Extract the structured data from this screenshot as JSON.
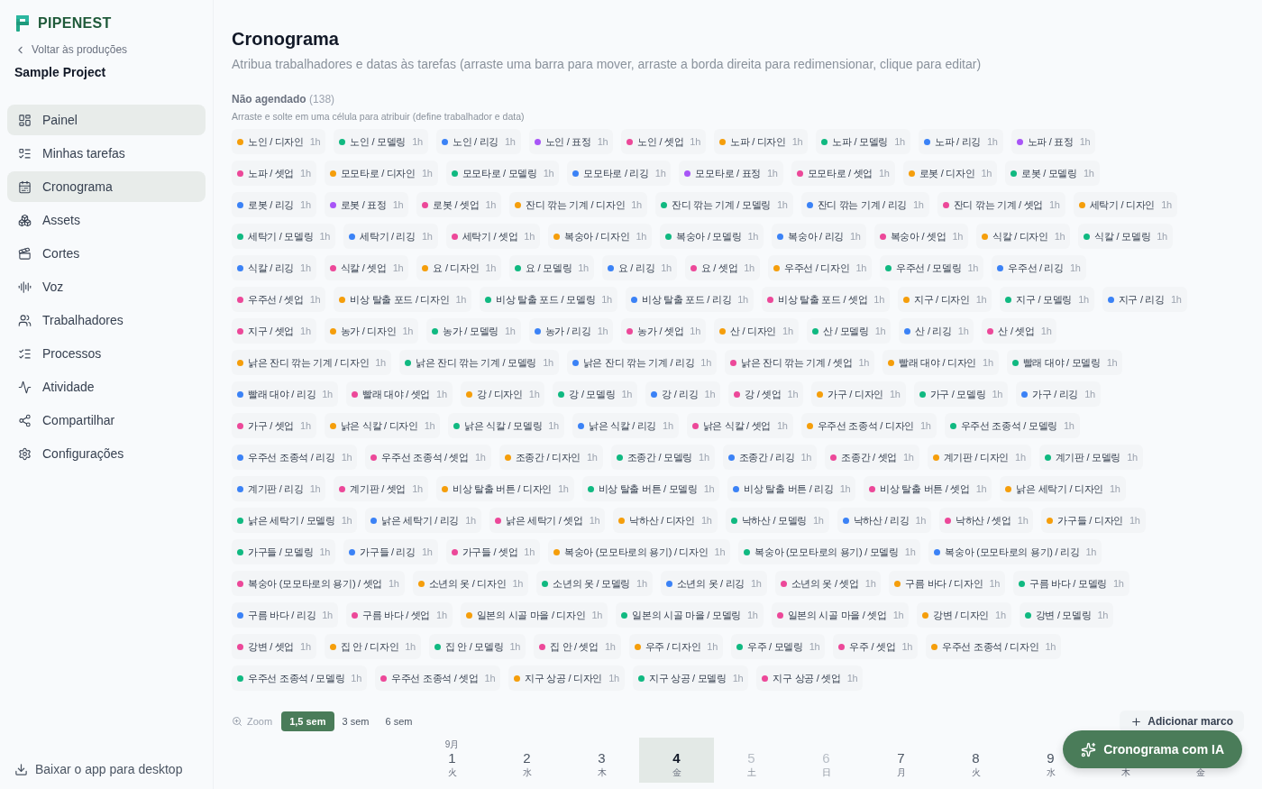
{
  "sidebar": {
    "brand": "PIPENEST",
    "back_link": "Voltar às produções",
    "project": "Sample Project",
    "items": [
      {
        "label": "Painel",
        "selected": true
      },
      {
        "label": "Minhas tarefas",
        "selected": false
      },
      {
        "label": "Cronograma",
        "selected": true
      },
      {
        "label": "Assets",
        "selected": false
      },
      {
        "label": "Cortes",
        "selected": false
      },
      {
        "label": "Voz",
        "selected": false
      },
      {
        "label": "Trabalhadores",
        "selected": false
      },
      {
        "label": "Processos",
        "selected": false
      },
      {
        "label": "Atividade",
        "selected": false
      },
      {
        "label": "Compartilhar",
        "selected": false
      },
      {
        "label": "Configurações",
        "selected": false
      }
    ],
    "download": "Baixar o app para desktop"
  },
  "page": {
    "title": "Cronograma",
    "subtitle": "Atribua trabalhadores e datas às tarefas (arraste uma barra para mover, arraste a borda direita para redimensionar, clique para editar)"
  },
  "unscheduled": {
    "title": "Não agendado",
    "count": "(138)",
    "hint": "Arraste e solte em uma célula para atribuir (define trabalhador e data)",
    "rows": [
      [
        {
          "label": "노인 / 디자인",
          "hours": "1h",
          "color": "#f59e0b"
        },
        {
          "label": "노인 / 모델링",
          "hours": "1h",
          "color": "#10b981"
        },
        {
          "label": "노인 / 리깅",
          "hours": "1h",
          "color": "#3b82f6"
        },
        {
          "label": "노인 / 표정",
          "hours": "1h",
          "color": "#a855f7"
        },
        {
          "label": "노인 / 셋업",
          "hours": "1h",
          "color": "#ec4899"
        },
        {
          "label": "노파 / 디자인",
          "hours": "1h",
          "color": "#f59e0b"
        },
        {
          "label": "노파 / 모델링",
          "hours": "1h",
          "color": "#10b981"
        },
        {
          "label": "노파 / 리깅",
          "hours": "1h",
          "color": "#3b82f6"
        },
        {
          "label": "노파 / 표정",
          "hours": "1h",
          "color": "#a855f7"
        }
      ],
      [
        {
          "label": "노파 / 셋업",
          "hours": "1h",
          "color": "#ec4899"
        },
        {
          "label": "모모타로 / 디자인",
          "hours": "1h",
          "color": "#f59e0b"
        },
        {
          "label": "모모타로 / 모델링",
          "hours": "1h",
          "color": "#10b981"
        },
        {
          "label": "모모타로 / 리깅",
          "hours": "1h",
          "color": "#3b82f6"
        },
        {
          "label": "모모타로 / 표정",
          "hours": "1h",
          "color": "#a855f7"
        },
        {
          "label": "모모타로 / 셋업",
          "hours": "1h",
          "color": "#ec4899"
        },
        {
          "label": "로봇 / 디자인",
          "hours": "1h",
          "color": "#f59e0b"
        },
        {
          "label": "로봇 / 모델링",
          "hours": "1h",
          "color": "#10b981"
        }
      ],
      [
        {
          "label": "로봇 / 리깅",
          "hours": "1h",
          "color": "#3b82f6"
        },
        {
          "label": "로봇 / 표정",
          "hours": "1h",
          "color": "#a855f7"
        },
        {
          "label": "로봇 / 셋업",
          "hours": "1h",
          "color": "#ec4899"
        },
        {
          "label": "잔디 깎는 기계 / 디자인",
          "hours": "1h",
          "color": "#f59e0b"
        },
        {
          "label": "잔디 깎는 기계 / 모델링",
          "hours": "1h",
          "color": "#10b981"
        },
        {
          "label": "잔디 깎는 기계 / 리깅",
          "hours": "1h",
          "color": "#3b82f6"
        },
        {
          "label": "잔디 깎는 기계 / 셋업",
          "hours": "1h",
          "color": "#ec4899"
        },
        {
          "label": "세탁기 / 디자인",
          "hours": "1h",
          "color": "#f59e0b"
        }
      ],
      [
        {
          "label": "세탁기 / 모델링",
          "hours": "1h",
          "color": "#10b981"
        },
        {
          "label": "세탁기 / 리깅",
          "hours": "1h",
          "color": "#3b82f6"
        },
        {
          "label": "세탁기 / 셋업",
          "hours": "1h",
          "color": "#ec4899"
        },
        {
          "label": "복숭아 / 디자인",
          "hours": "1h",
          "color": "#f59e0b"
        },
        {
          "label": "복숭아 / 모델링",
          "hours": "1h",
          "color": "#10b981"
        },
        {
          "label": "복숭아 / 리깅",
          "hours": "1h",
          "color": "#3b82f6"
        },
        {
          "label": "복숭아 / 셋업",
          "hours": "1h",
          "color": "#ec4899"
        },
        {
          "label": "식칼 / 디자인",
          "hours": "1h",
          "color": "#f59e0b"
        },
        {
          "label": "식칼 / 모델링",
          "hours": "1h",
          "color": "#10b981"
        }
      ],
      [
        {
          "label": "식칼 / 리깅",
          "hours": "1h",
          "color": "#3b82f6"
        },
        {
          "label": "식칼 / 셋업",
          "hours": "1h",
          "color": "#ec4899"
        },
        {
          "label": "요 / 디자인",
          "hours": "1h",
          "color": "#f59e0b"
        },
        {
          "label": "요 / 모델링",
          "hours": "1h",
          "color": "#10b981"
        },
        {
          "label": "요 / 리깅",
          "hours": "1h",
          "color": "#3b82f6"
        },
        {
          "label": "요 / 셋업",
          "hours": "1h",
          "color": "#ec4899"
        },
        {
          "label": "우주선 / 디자인",
          "hours": "1h",
          "color": "#f59e0b"
        },
        {
          "label": "우주선 / 모델링",
          "hours": "1h",
          "color": "#10b981"
        },
        {
          "label": "우주선 / 리깅",
          "hours": "1h",
          "color": "#3b82f6"
        }
      ],
      [
        {
          "label": "우주선 / 셋업",
          "hours": "1h",
          "color": "#ec4899"
        },
        {
          "label": "비상 탈출 포드 / 디자인",
          "hours": "1h",
          "color": "#f59e0b"
        },
        {
          "label": "비상 탈출 포드 / 모델링",
          "hours": "1h",
          "color": "#10b981"
        },
        {
          "label": "비상 탈출 포드 / 리깅",
          "hours": "1h",
          "color": "#3b82f6"
        },
        {
          "label": "비상 탈출 포드 / 셋업",
          "hours": "1h",
          "color": "#ec4899"
        },
        {
          "label": "지구 / 디자인",
          "hours": "1h",
          "color": "#f59e0b"
        },
        {
          "label": "지구 / 모델링",
          "hours": "1h",
          "color": "#10b981"
        },
        {
          "label": "지구 / 리깅",
          "hours": "1h",
          "color": "#3b82f6"
        }
      ],
      [
        {
          "label": "지구 / 셋업",
          "hours": "1h",
          "color": "#ec4899"
        },
        {
          "label": "농가 / 디자인",
          "hours": "1h",
          "color": "#f59e0b"
        },
        {
          "label": "농가 / 모델링",
          "hours": "1h",
          "color": "#10b981"
        },
        {
          "label": "농가 / 리깅",
          "hours": "1h",
          "color": "#3b82f6"
        },
        {
          "label": "농가 / 셋업",
          "hours": "1h",
          "color": "#ec4899"
        },
        {
          "label": "산 / 디자인",
          "hours": "1h",
          "color": "#f59e0b"
        },
        {
          "label": "산 / 모델링",
          "hours": "1h",
          "color": "#10b981"
        },
        {
          "label": "산 / 리깅",
          "hours": "1h",
          "color": "#3b82f6"
        },
        {
          "label": "산 / 셋업",
          "hours": "1h",
          "color": "#ec4899"
        }
      ],
      [
        {
          "label": "낡은 잔디 깎는 기계 / 디자인",
          "hours": "1h",
          "color": "#f59e0b"
        },
        {
          "label": "낡은 잔디 깎는 기계 / 모델링",
          "hours": "1h",
          "color": "#10b981"
        },
        {
          "label": "낡은 잔디 깎는 기계 / 리깅",
          "hours": "1h",
          "color": "#3b82f6"
        },
        {
          "label": "낡은 잔디 깎는 기계 / 셋업",
          "hours": "1h",
          "color": "#ec4899"
        },
        {
          "label": "빨래 대야 / 디자인",
          "hours": "1h",
          "color": "#f59e0b"
        },
        {
          "label": "빨래 대야 / 모델링",
          "hours": "1h",
          "color": "#10b981"
        }
      ],
      [
        {
          "label": "빨래 대야 / 리깅",
          "hours": "1h",
          "color": "#3b82f6"
        },
        {
          "label": "빨래 대야 / 셋업",
          "hours": "1h",
          "color": "#ec4899"
        },
        {
          "label": "강 / 디자인",
          "hours": "1h",
          "color": "#f59e0b"
        },
        {
          "label": "강 / 모델링",
          "hours": "1h",
          "color": "#10b981"
        },
        {
          "label": "강 / 리깅",
          "hours": "1h",
          "color": "#3b82f6"
        },
        {
          "label": "강 / 셋업",
          "hours": "1h",
          "color": "#ec4899"
        },
        {
          "label": "가구 / 디자인",
          "hours": "1h",
          "color": "#f59e0b"
        },
        {
          "label": "가구 / 모델링",
          "hours": "1h",
          "color": "#10b981"
        },
        {
          "label": "가구 / 리깅",
          "hours": "1h",
          "color": "#3b82f6"
        }
      ],
      [
        {
          "label": "가구 / 셋업",
          "hours": "1h",
          "color": "#ec4899"
        },
        {
          "label": "낡은 식칼 / 디자인",
          "hours": "1h",
          "color": "#f59e0b"
        },
        {
          "label": "낡은 식칼 / 모델링",
          "hours": "1h",
          "color": "#10b981"
        },
        {
          "label": "낡은 식칼 / 리깅",
          "hours": "1h",
          "color": "#3b82f6"
        },
        {
          "label": "낡은 식칼 / 셋업",
          "hours": "1h",
          "color": "#ec4899"
        },
        {
          "label": "우주선 조종석 / 디자인",
          "hours": "1h",
          "color": "#f59e0b"
        },
        {
          "label": "우주선 조종석 / 모델링",
          "hours": "1h",
          "color": "#10b981"
        }
      ],
      [
        {
          "label": "우주선 조종석 / 리깅",
          "hours": "1h",
          "color": "#3b82f6"
        },
        {
          "label": "우주선 조종석 / 셋업",
          "hours": "1h",
          "color": "#ec4899"
        },
        {
          "label": "조종간 / 디자인",
          "hours": "1h",
          "color": "#f59e0b"
        },
        {
          "label": "조종간 / 모델링",
          "hours": "1h",
          "color": "#10b981"
        },
        {
          "label": "조종간 / 리깅",
          "hours": "1h",
          "color": "#3b82f6"
        },
        {
          "label": "조종간 / 셋업",
          "hours": "1h",
          "color": "#ec4899"
        },
        {
          "label": "계기판 / 디자인",
          "hours": "1h",
          "color": "#f59e0b"
        },
        {
          "label": "계기판 / 모델링",
          "hours": "1h",
          "color": "#10b981"
        }
      ],
      [
        {
          "label": "계기판 / 리깅",
          "hours": "1h",
          "color": "#3b82f6"
        },
        {
          "label": "계기판 / 셋업",
          "hours": "1h",
          "color": "#ec4899"
        },
        {
          "label": "비상 탈출 버튼 / 디자인",
          "hours": "1h",
          "color": "#f59e0b"
        },
        {
          "label": "비상 탈출 버튼 / 모델링",
          "hours": "1h",
          "color": "#10b981"
        },
        {
          "label": "비상 탈출 버튼 / 리깅",
          "hours": "1h",
          "color": "#3b82f6"
        },
        {
          "label": "비상 탈출 버튼 / 셋업",
          "hours": "1h",
          "color": "#ec4899"
        },
        {
          "label": "낡은 세탁기 / 디자인",
          "hours": "1h",
          "color": "#f59e0b"
        }
      ],
      [
        {
          "label": "낡은 세탁기 / 모델링",
          "hours": "1h",
          "color": "#10b981"
        },
        {
          "label": "낡은 세탁기 / 리깅",
          "hours": "1h",
          "color": "#3b82f6"
        },
        {
          "label": "낡은 세탁기 / 셋업",
          "hours": "1h",
          "color": "#ec4899"
        },
        {
          "label": "낙하산 / 디자인",
          "hours": "1h",
          "color": "#f59e0b"
        },
        {
          "label": "낙하산 / 모델링",
          "hours": "1h",
          "color": "#10b981"
        },
        {
          "label": "낙하산 / 리깅",
          "hours": "1h",
          "color": "#3b82f6"
        },
        {
          "label": "낙하산 / 셋업",
          "hours": "1h",
          "color": "#ec4899"
        },
        {
          "label": "가구들 / 디자인",
          "hours": "1h",
          "color": "#f59e0b"
        }
      ],
      [
        {
          "label": "가구들 / 모델링",
          "hours": "1h",
          "color": "#10b981"
        },
        {
          "label": "가구들 / 리깅",
          "hours": "1h",
          "color": "#3b82f6"
        },
        {
          "label": "가구들 / 셋업",
          "hours": "1h",
          "color": "#ec4899"
        },
        {
          "label": "복숭아 (모모타로의 용기) / 디자인",
          "hours": "1h",
          "color": "#f59e0b"
        },
        {
          "label": "복숭아 (모모타로의 용기) / 모델링",
          "hours": "1h",
          "color": "#10b981"
        },
        {
          "label": "복숭아 (모모타로의 용기) / 리깅",
          "hours": "1h",
          "color": "#3b82f6"
        }
      ],
      [
        {
          "label": "복숭아 (모모타로의 용기) / 셋업",
          "hours": "1h",
          "color": "#ec4899"
        },
        {
          "label": "소년의 옷 / 디자인",
          "hours": "1h",
          "color": "#f59e0b"
        },
        {
          "label": "소년의 옷 / 모델링",
          "hours": "1h",
          "color": "#10b981"
        },
        {
          "label": "소년의 옷 / 리깅",
          "hours": "1h",
          "color": "#3b82f6"
        },
        {
          "label": "소년의 옷 / 셋업",
          "hours": "1h",
          "color": "#ec4899"
        },
        {
          "label": "구름 바다 / 디자인",
          "hours": "1h",
          "color": "#f59e0b"
        },
        {
          "label": "구름 바다 / 모델링",
          "hours": "1h",
          "color": "#10b981"
        }
      ],
      [
        {
          "label": "구름 바다 / 리깅",
          "hours": "1h",
          "color": "#3b82f6"
        },
        {
          "label": "구름 바다 / 셋업",
          "hours": "1h",
          "color": "#ec4899"
        },
        {
          "label": "일본의 시골 마을 / 디자인",
          "hours": "1h",
          "color": "#f59e0b"
        },
        {
          "label": "일본의 시골 마을 / 모델링",
          "hours": "1h",
          "color": "#10b981"
        },
        {
          "label": "일본의 시골 마을 / 셋업",
          "hours": "1h",
          "color": "#ec4899"
        },
        {
          "label": "강변 / 디자인",
          "hours": "1h",
          "color": "#f59e0b"
        },
        {
          "label": "강변 / 모델링",
          "hours": "1h",
          "color": "#10b981"
        }
      ],
      [
        {
          "label": "강변 / 셋업",
          "hours": "1h",
          "color": "#ec4899"
        },
        {
          "label": "집 안 / 디자인",
          "hours": "1h",
          "color": "#f59e0b"
        },
        {
          "label": "집 안 / 모델링",
          "hours": "1h",
          "color": "#10b981"
        },
        {
          "label": "집 안 / 셋업",
          "hours": "1h",
          "color": "#ec4899"
        },
        {
          "label": "우주 / 디자인",
          "hours": "1h",
          "color": "#f59e0b"
        },
        {
          "label": "우주 / 모델링",
          "hours": "1h",
          "color": "#10b981"
        },
        {
          "label": "우주 / 셋업",
          "hours": "1h",
          "color": "#ec4899"
        },
        {
          "label": "우주선 조종석 / 디자인",
          "hours": "1h",
          "color": "#f59e0b"
        }
      ],
      [
        {
          "label": "우주선 조종석 / 모델링",
          "hours": "1h",
          "color": "#10b981"
        },
        {
          "label": "우주선 조종석 / 셋업",
          "hours": "1h",
          "color": "#ec4899"
        },
        {
          "label": "지구 상공 / 디자인",
          "hours": "1h",
          "color": "#f59e0b"
        },
        {
          "label": "지구 상공 / 모델링",
          "hours": "1h",
          "color": "#10b981"
        },
        {
          "label": "지구 상공 / 셋업",
          "hours": "1h",
          "color": "#ec4899"
        }
      ]
    ]
  },
  "toolbar": {
    "zoom_label": "Zoom",
    "zoom_options": [
      {
        "label": "1,5 sem",
        "selected": true
      },
      {
        "label": "3 sem",
        "selected": false
      },
      {
        "label": "6 sem",
        "selected": false
      }
    ],
    "add_milestone": "Adicionar marco"
  },
  "timeline": {
    "days": [
      {
        "month": "9月",
        "day": "1",
        "weekday": "火",
        "selected": false,
        "weekend": false
      },
      {
        "day": "2",
        "weekday": "水",
        "selected": false,
        "weekend": false
      },
      {
        "day": "3",
        "weekday": "木",
        "selected": false,
        "weekend": false
      },
      {
        "day": "4",
        "weekday": "金",
        "selected": true,
        "weekend": false
      },
      {
        "day": "5",
        "weekday": "土",
        "selected": false,
        "weekend": true
      },
      {
        "day": "6",
        "weekday": "日",
        "selected": false,
        "weekend": true
      },
      {
        "day": "7",
        "weekday": "月",
        "selected": false,
        "weekend": false
      },
      {
        "day": "8",
        "weekday": "火",
        "selected": false,
        "weekend": false
      },
      {
        "day": "9",
        "weekday": "水",
        "selected": false,
        "weekend": false
      },
      {
        "weekday": "木",
        "selected": false,
        "weekend": false
      },
      {
        "weekday": "金",
        "selected": false,
        "weekend": false
      }
    ]
  },
  "ai_button": "Cronograma com IA"
}
